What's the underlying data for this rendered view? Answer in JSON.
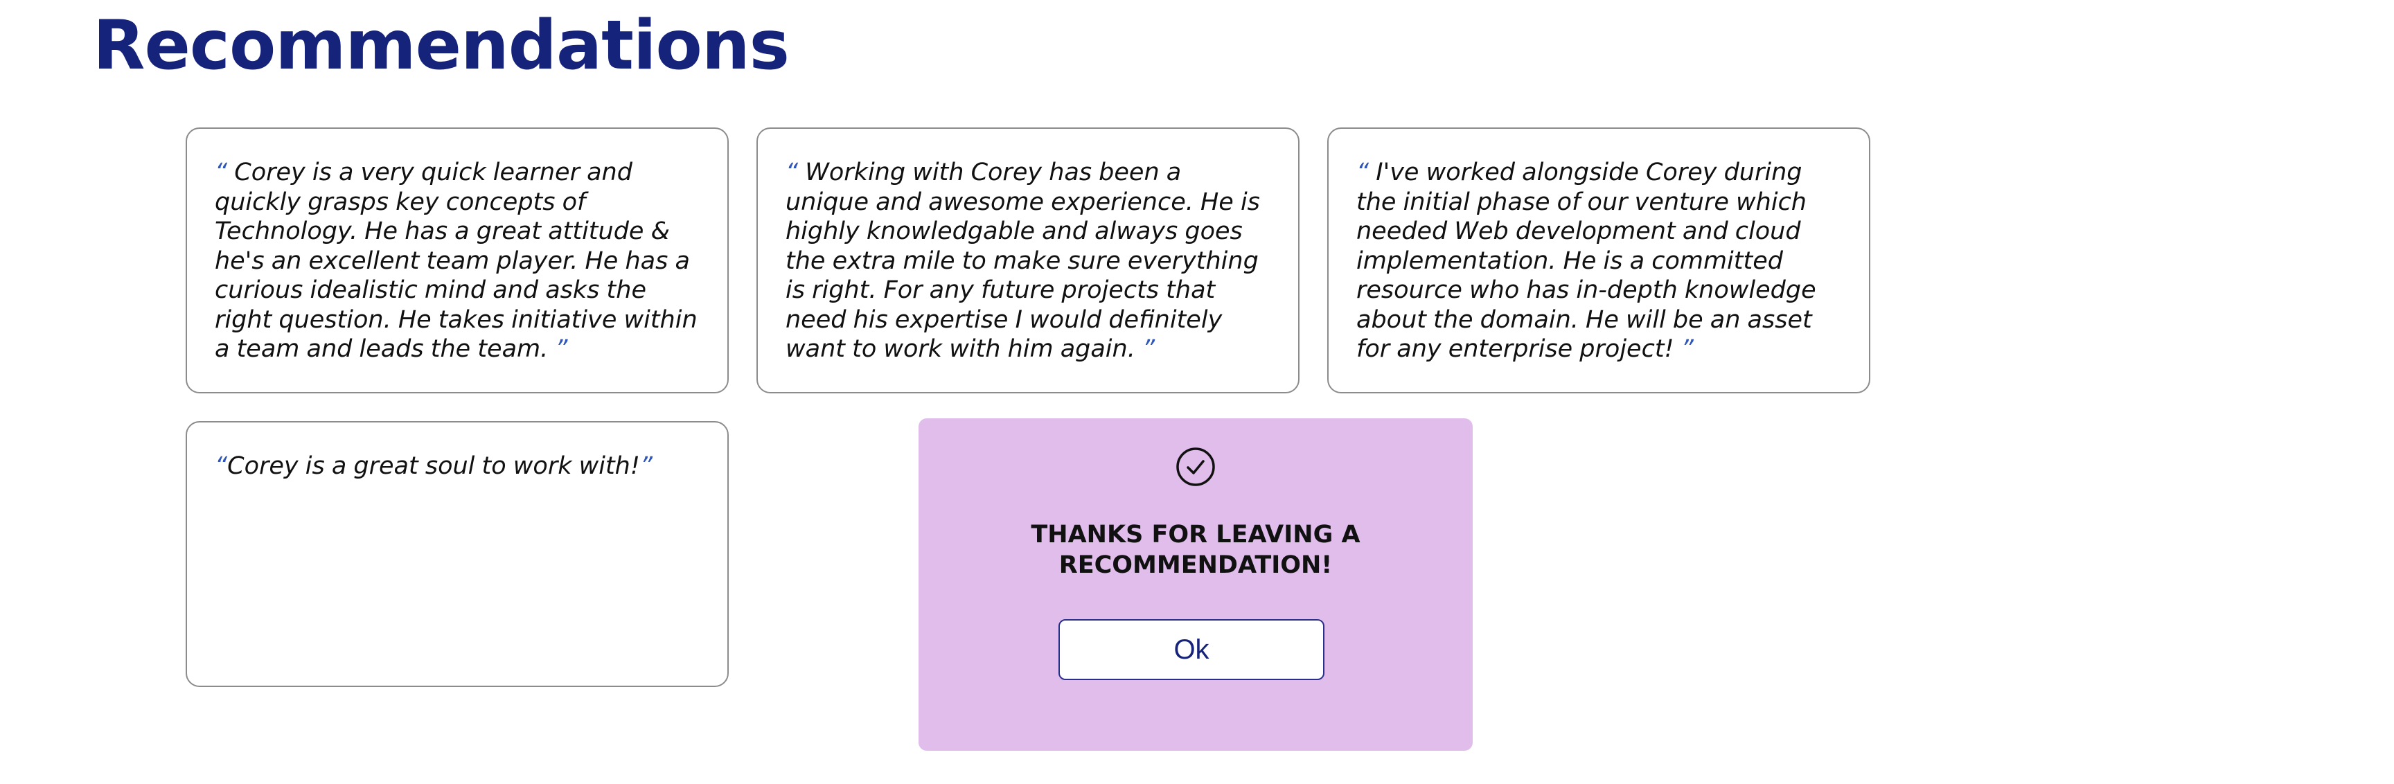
{
  "page": {
    "title": "Recommendations"
  },
  "recommendations": [
    {
      "open_quote": "“",
      "text": " Corey is a very quick learner and quickly grasps key concepts of Technology. He has a great attitude & he's an excellent team player. He has a curious idealistic mind and asks the right question. He takes initiative within a team and leads the team. ",
      "close_quote": "”"
    },
    {
      "open_quote": "“",
      "text": " Working with Corey has been a unique and awesome experience. He is highly knowledgable and always goes the extra mile to make sure everything is right. For any future projects that need his expertise I would definitely want to work with him again. ",
      "close_quote": "”"
    },
    {
      "open_quote": "“",
      "text": " I've worked alongside Corey during the initial phase of our venture which needed Web development and cloud implementation. He is a committed resource who has in-depth knowledge about the domain. He will be an asset for any enterprise project! ",
      "close_quote": "”"
    },
    {
      "open_quote": "“",
      "text": "Corey is a great soul to work with!",
      "close_quote": "”"
    }
  ],
  "modal": {
    "icon": "check-circle-icon",
    "message": "THANKS FOR LEAVING A RECOMMENDATION!",
    "ok_label": "Ok",
    "background_color": "#e1bdec"
  },
  "colors": {
    "title": "#16237a",
    "quote_mark": "#2d56b8",
    "card_border": "#8c8c8c"
  }
}
